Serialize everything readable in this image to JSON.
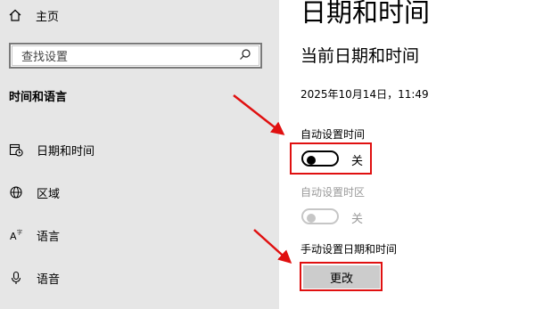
{
  "sidebar": {
    "home_label": "主页",
    "search_placeholder": "查找设置",
    "section_title": "时间和语言",
    "items": [
      {
        "label": "日期和时间",
        "icon": "calendar-clock-icon"
      },
      {
        "label": "区域",
        "icon": "globe-icon"
      },
      {
        "label": "语言",
        "icon": "language-icon"
      },
      {
        "label": "语音",
        "icon": "microphone-icon"
      }
    ]
  },
  "main": {
    "title": "日期和时间",
    "subtitle": "当前日期和时间",
    "current_datetime": "2025年10月14日，11:49",
    "auto_time": {
      "label": "自动设置时间",
      "state": "关",
      "enabled": true
    },
    "auto_timezone": {
      "label": "自动设置时区",
      "state": "关",
      "enabled": false
    },
    "manual": {
      "label": "手动设置日期和时间",
      "button": "更改"
    }
  },
  "colors": {
    "sidebar_bg": "#e6e6e6",
    "highlight": "#e01010",
    "button_bg": "#cccccc",
    "disabled": "#9a9a9a"
  }
}
